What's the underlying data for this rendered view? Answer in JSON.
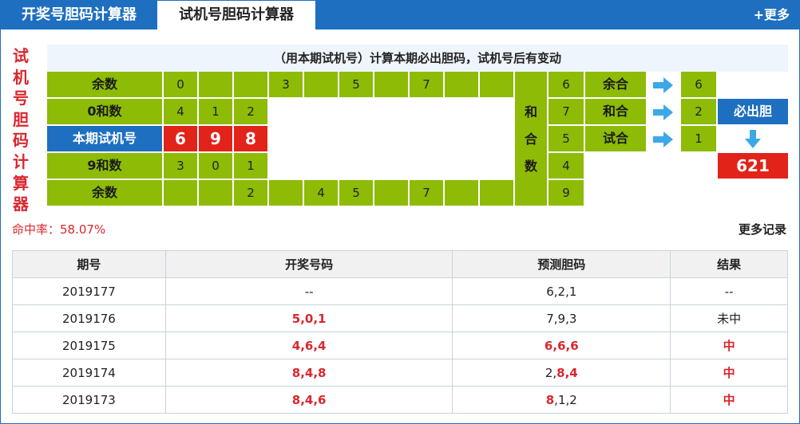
{
  "tabs": [
    {
      "label": "开奖号胆码计算器"
    },
    {
      "label": "试机号胆码计算器"
    }
  ],
  "more_top": "+更多",
  "vertical_title": [
    "试",
    "机",
    "号",
    "胆",
    "码",
    "计",
    "算",
    "器"
  ],
  "calc": {
    "heading": "（用本期试机号）计算本期必出胆码，试机号后有变动",
    "rows": {
      "r1": {
        "label": "余数",
        "cells": [
          "0",
          "",
          "",
          "3",
          "",
          "5",
          "",
          "7",
          "",
          ""
        ],
        "num": "6",
        "tag": "余合",
        "result": "6"
      },
      "r2": {
        "label": "0和数",
        "cells": [
          "4",
          "1",
          "2"
        ],
        "num": "7",
        "tag": "和合",
        "result": "2"
      },
      "r3": {
        "label": "本期试机号",
        "cells": [
          "6",
          "9",
          "8"
        ],
        "num": "5",
        "tag": "试合",
        "result": "1"
      },
      "r4": {
        "label": "9和数",
        "cells": [
          "3",
          "0",
          "1"
        ],
        "num": "4"
      },
      "r5": {
        "label": "余数",
        "cells": [
          "",
          "",
          "2",
          "",
          "4",
          "5",
          "",
          "7",
          "",
          ""
        ],
        "num": "9"
      }
    },
    "he_chars": [
      "和",
      "合",
      "数"
    ],
    "must_label": "必出胆",
    "must_value": "621"
  },
  "hit_rate": "命中率：58.07%",
  "more_records": "更多记录",
  "history": {
    "headers": [
      "期号",
      "开奖号码",
      "预测胆码",
      "结果"
    ],
    "rows": [
      {
        "issue": "2019177",
        "draw": "--",
        "pred": [
          [
            "6",
            false
          ],
          [
            ",",
            false
          ],
          [
            "2",
            false
          ],
          [
            ",",
            false
          ],
          [
            "1",
            false
          ]
        ],
        "result": "--",
        "result_red": false,
        "draw_red": false
      },
      {
        "issue": "2019176",
        "draw": "5,0,1",
        "pred": [
          [
            "7",
            false
          ],
          [
            ",",
            false
          ],
          [
            "9",
            false
          ],
          [
            ",",
            false
          ],
          [
            "3",
            false
          ]
        ],
        "result": "未中",
        "result_red": false,
        "draw_red": true
      },
      {
        "issue": "2019175",
        "draw": "4,6,4",
        "pred": [
          [
            "6",
            true
          ],
          [
            ",",
            true
          ],
          [
            "6",
            true
          ],
          [
            ",",
            true
          ],
          [
            "6",
            true
          ]
        ],
        "result": "中",
        "result_red": true,
        "draw_red": true
      },
      {
        "issue": "2019174",
        "draw": "8,4,8",
        "pred": [
          [
            "2",
            false
          ],
          [
            ",",
            false
          ],
          [
            "8",
            true
          ],
          [
            ",",
            true
          ],
          [
            "4",
            true
          ]
        ],
        "result": "中",
        "result_red": true,
        "draw_red": true
      },
      {
        "issue": "2019173",
        "draw": "8,4,6",
        "pred": [
          [
            "8",
            true
          ],
          [
            ",",
            false
          ],
          [
            "1",
            false
          ],
          [
            ",",
            false
          ],
          [
            "2",
            false
          ]
        ],
        "result": "中",
        "result_red": true,
        "draw_red": true
      }
    ]
  },
  "colors": {
    "brand_blue": "#1e6fc0",
    "green": "#8dbb06",
    "red": "#e2231a",
    "arrow_blue": "#3da8e8"
  },
  "icons": {
    "arrow_right": "arrow-right-icon",
    "arrow_down": "arrow-down-icon"
  }
}
